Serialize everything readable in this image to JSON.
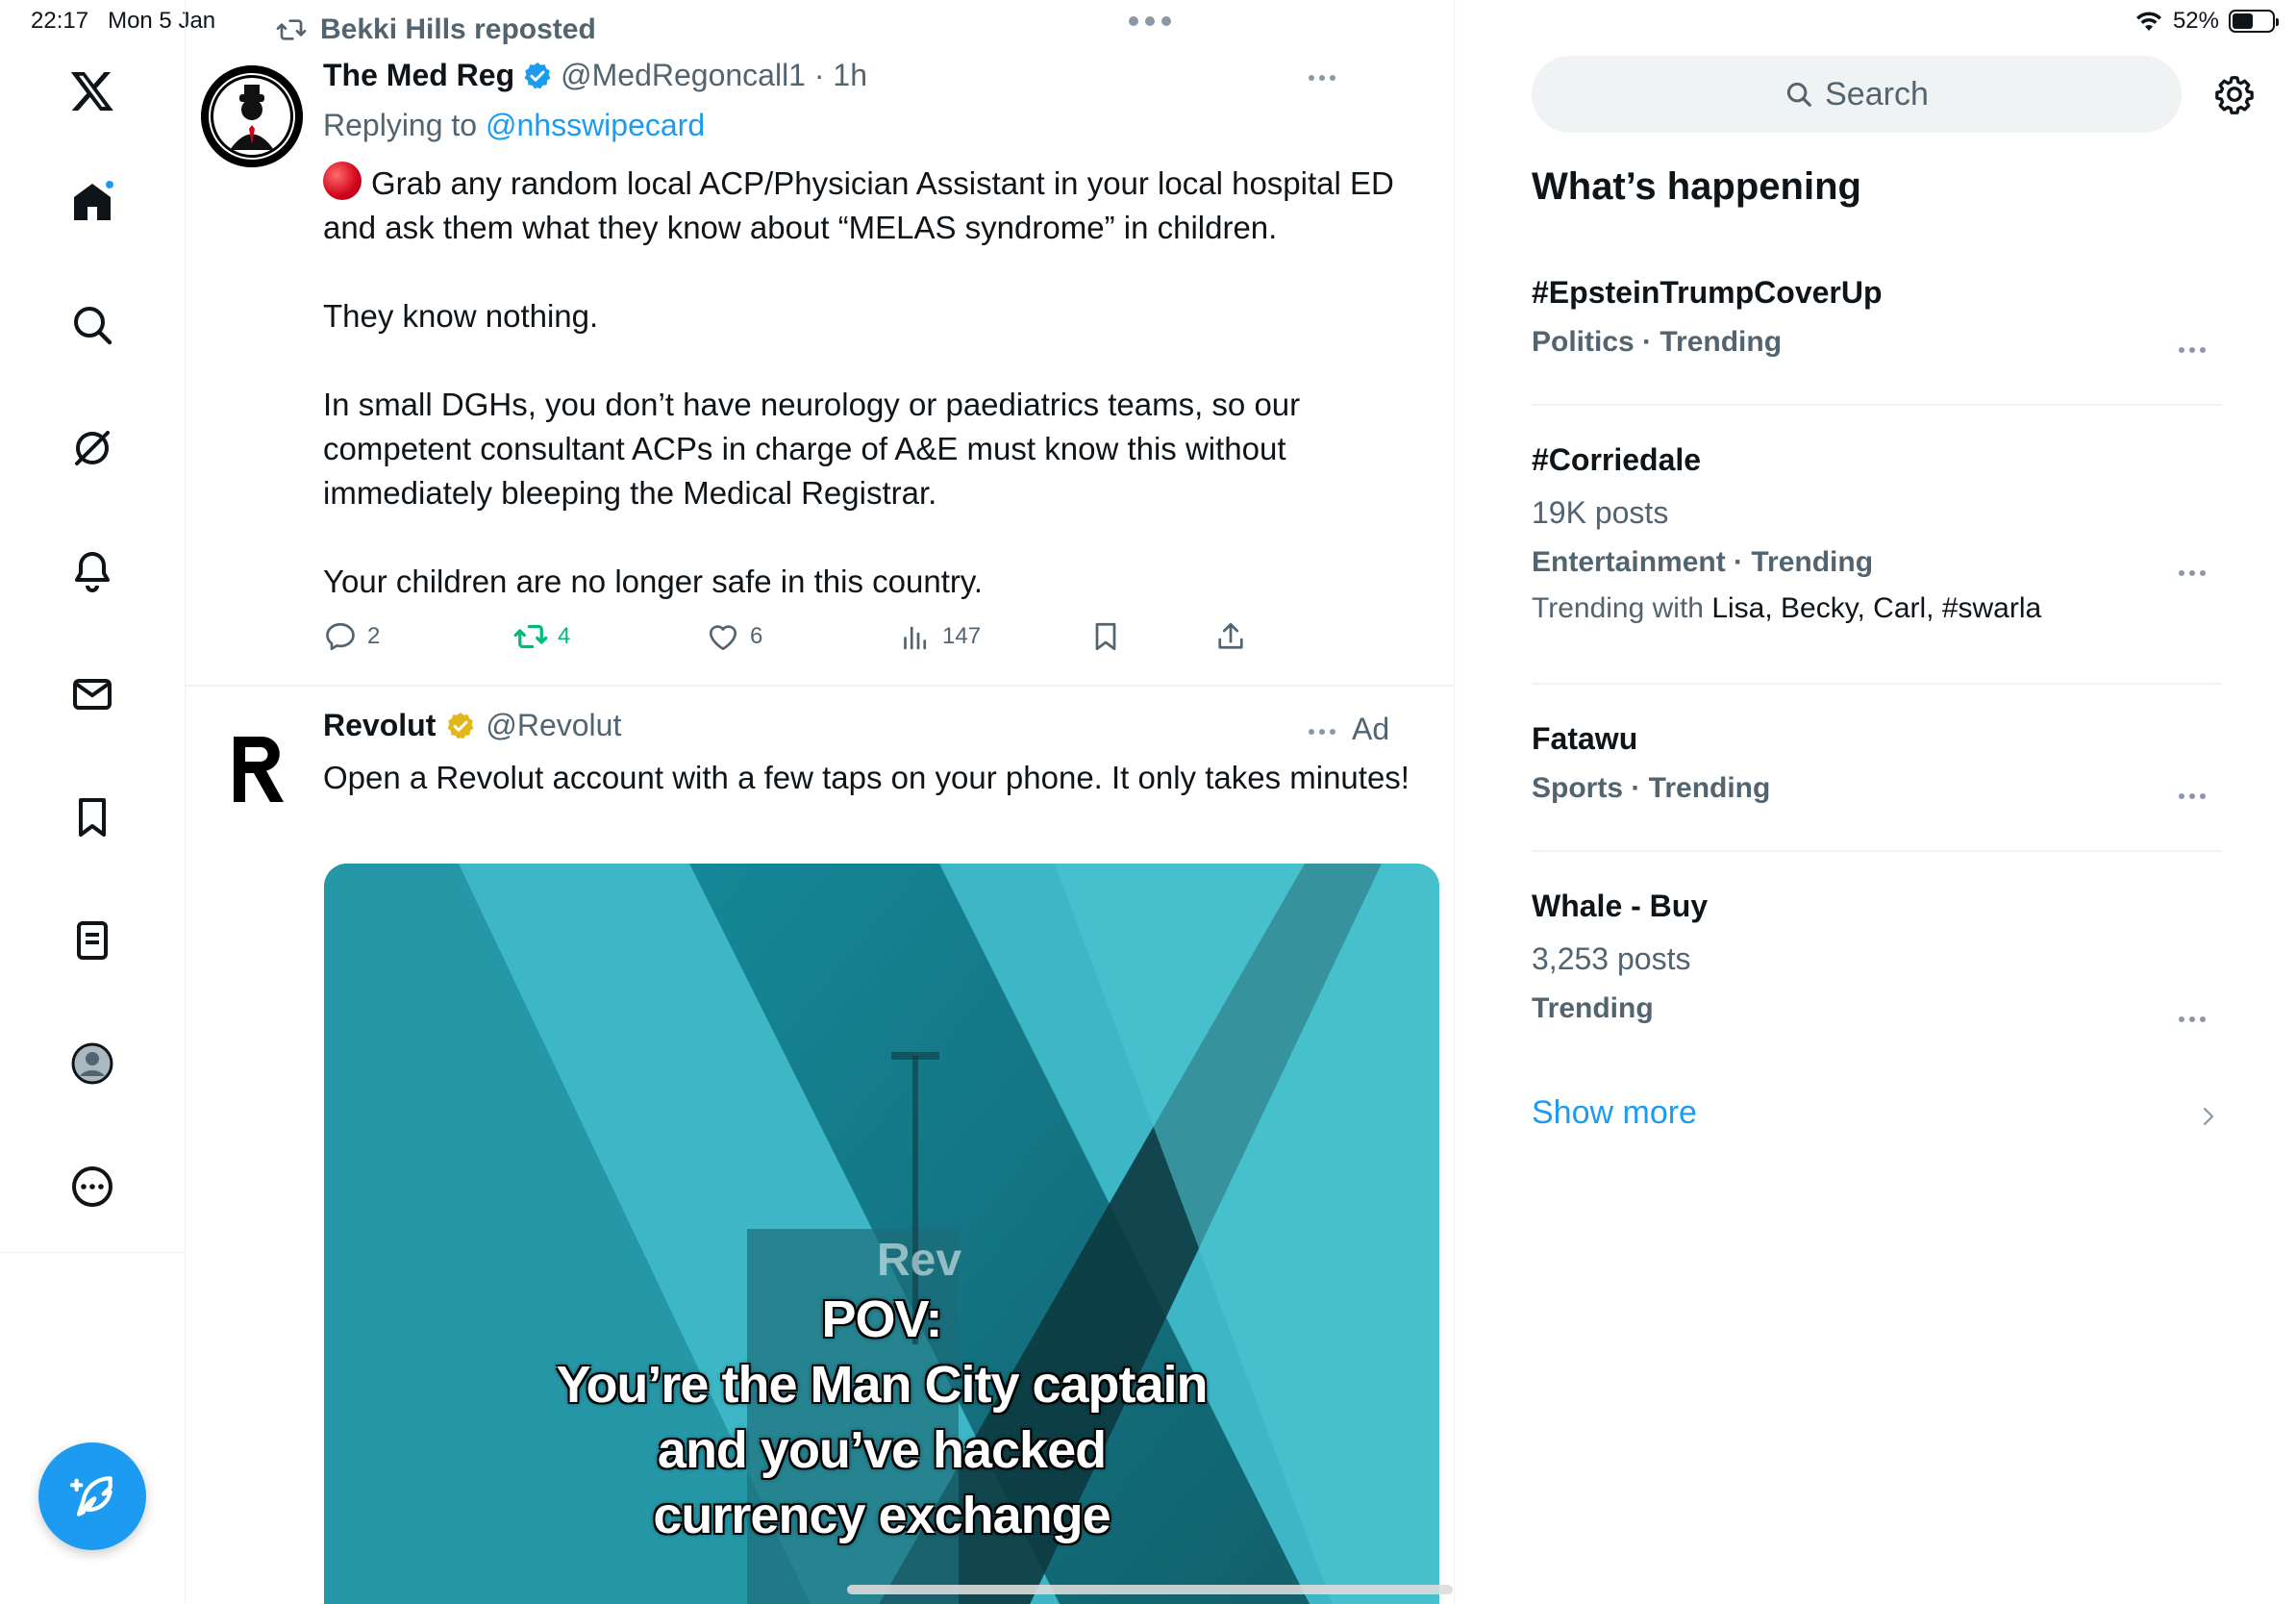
{
  "status_bar": {
    "time": "22:17",
    "date": "Mon 5 Jan",
    "battery": "52%",
    "battery_level": 0.52
  },
  "nav": {
    "items": [
      "x-logo",
      "home",
      "search",
      "grok",
      "notifications",
      "messages",
      "bookmarks",
      "lists",
      "profile",
      "more"
    ],
    "home_has_notification": true
  },
  "feed": {
    "post1": {
      "reposted_by": "Bekki Hills reposted",
      "author_name": "The Med Reg",
      "handle_time": "@MedRegoncall1 · 1h",
      "replying_prefix": "Replying to ",
      "replying_to": "@nhsswipecard",
      "paragraphs": [
        "Grab any random local ACP/Physician Assistant in your local hospital ED and ask them what they know about “MELAS syndrome” in children.",
        "They know nothing.",
        "In small DGHs, you don’t have neurology or paediatrics teams, so our competent consultant ACPs in charge of A&E must know this without immediately bleeping the Medical Registrar.",
        "Your children are no longer safe in this country."
      ],
      "replies": "2",
      "reposts": "4",
      "likes": "6",
      "views": "147"
    },
    "post2": {
      "author_name": "Revolut",
      "handle": "@Revolut",
      "ad_label": "Ad",
      "body": "Open a Revolut account with a few taps on your phone. It only takes minutes!",
      "media_caption": [
        "POV:",
        "You’re  the Man City captain",
        "and you’ve hacked",
        "currency exchange"
      ],
      "media_sign": "Rev"
    }
  },
  "sidebar": {
    "search_placeholder": "Search",
    "title": "What’s happening",
    "trends": [
      {
        "name": "#EpsteinTrumpCoverUp",
        "posts": "",
        "meta": "Politics · Trending",
        "with_prefix": "",
        "with": ""
      },
      {
        "name": "#Corriedale",
        "posts": "19K posts",
        "meta": "Entertainment · Trending",
        "with_prefix": "Trending with ",
        "with": "Lisa, Becky, Carl, #swarla"
      },
      {
        "name": "Fatawu",
        "posts": "",
        "meta": "Sports · Trending",
        "with_prefix": "",
        "with": ""
      },
      {
        "name": "Whale - Buy",
        "posts": "3,253 posts",
        "meta": "Trending",
        "with_prefix": "",
        "with": ""
      }
    ],
    "show_more": "Show more"
  },
  "colors": {
    "accent": "#1d9bf0",
    "repost_green": "#00ba7c",
    "muted_text": "#536471"
  }
}
